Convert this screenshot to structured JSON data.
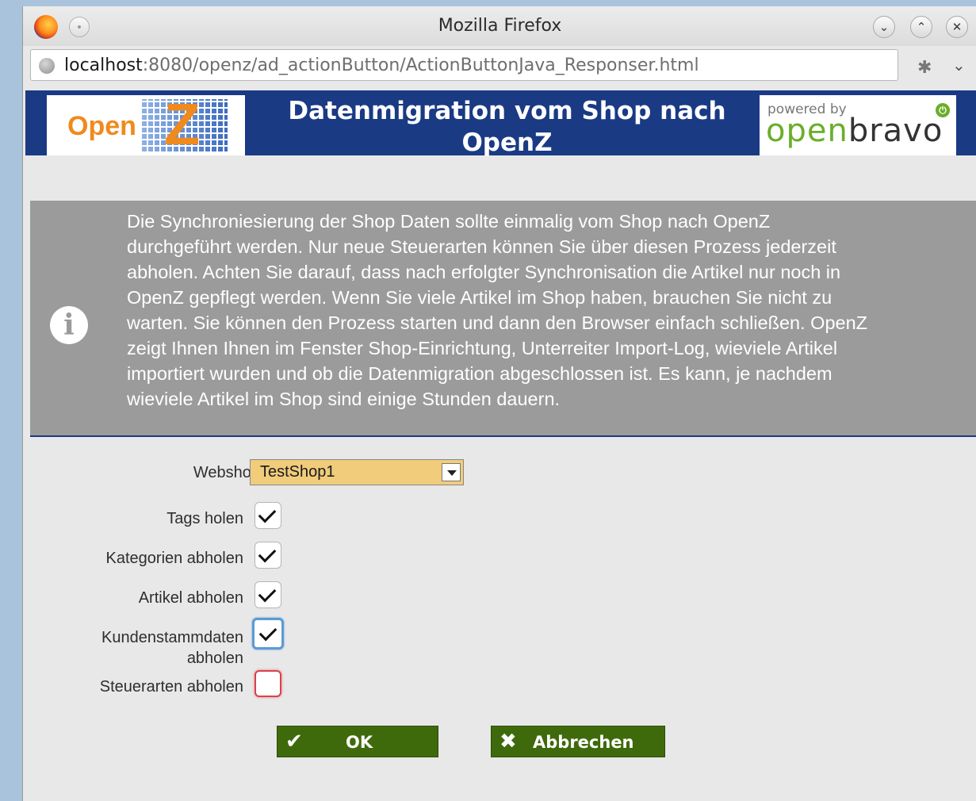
{
  "browser": {
    "window_title": "Mozilla Firefox",
    "url_host": "localhost",
    "url_rest": ":8080/openz/ad_actionButton/ActionButtonJava_Responser.html",
    "controls": {
      "minimize": "⌄",
      "maximize": "⌃",
      "close": "✕"
    }
  },
  "header": {
    "title": "Datenmigration vom Shop nach OpenZ",
    "logo_left_text": "Open",
    "logo_left_letter": "Z",
    "logo_right_powered": "powered by",
    "logo_right_open": "open",
    "logo_right_bravo": "bravo"
  },
  "info": {
    "icon": "info-icon",
    "text": "Die Synchroniesierung der Shop Daten sollte einmalig vom Shop nach OpenZ durchgeführt werden. Nur neue Steuerarten können Sie über diesen Prozess jederzeit abholen. Achten Sie darauf, dass nach erfolgter Synchronisation die Artikel nur noch in OpenZ gepflegt werden. Wenn Sie viele Artikel im Shop haben, brauchen Sie nicht zu warten. Sie können den Prozess starten und dann den Browser einfach schließen. OpenZ zeigt Ihnen Ihnen im Fenster Shop-Einrichtung, Unterreiter Import-Log, wieviele Artikel importiert wurden und ob die Datenmigration abgeschlossen ist. Es kann, je nachdem wieviele Artikel im Shop sind einige Stunden dauern."
  },
  "form": {
    "webshop_label": "Webshop",
    "webshop_value": "TestShop1",
    "tags_label": "Tags holen",
    "tags_checked": true,
    "categories_label": "Kategorien abholen",
    "categories_checked": true,
    "articles_label": "Artikel abholen",
    "articles_checked": true,
    "customers_label_line1": "Kundenstammdaten",
    "customers_label_line2": "abholen",
    "customers_checked": true,
    "taxes_label": "Steuerarten abholen",
    "taxes_checked": false
  },
  "buttons": {
    "ok_label": "OK",
    "cancel_label": "Abbrechen",
    "accent": "#3f6a0c"
  },
  "colors": {
    "header_bg": "#1a3a84",
    "info_bg": "#9b9b9b",
    "select_bg": "#f0cc7b",
    "required_border": "#d9424b"
  }
}
